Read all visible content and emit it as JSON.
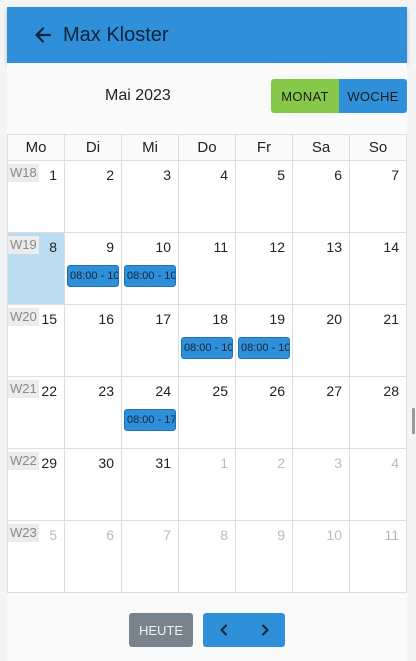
{
  "header": {
    "title": "Max Kloster",
    "back_icon": "arrow-left-icon"
  },
  "toolbar": {
    "month_label": "Mai 2023",
    "monat_label": "MONAT",
    "woche_label": "WOCHE"
  },
  "calendar": {
    "weekdays": [
      "Mo",
      "Di",
      "Mi",
      "Do",
      "Fr",
      "Sa",
      "So"
    ],
    "weeks": [
      {
        "label": "W18",
        "days": [
          "1",
          "2",
          "3",
          "4",
          "5",
          "6",
          "7"
        ]
      },
      {
        "label": "W19",
        "days": [
          "8",
          "9",
          "10",
          "11",
          "12",
          "13",
          "14"
        ]
      },
      {
        "label": "W20",
        "days": [
          "15",
          "16",
          "17",
          "18",
          "19",
          "20",
          "21"
        ]
      },
      {
        "label": "W21",
        "days": [
          "22",
          "23",
          "24",
          "25",
          "26",
          "27",
          "28"
        ]
      },
      {
        "label": "W22",
        "days": [
          "29",
          "30",
          "31",
          "1",
          "2",
          "3",
          "4"
        ]
      },
      {
        "label": "W23",
        "days": [
          "5",
          "6",
          "7",
          "8",
          "9",
          "10",
          "11"
        ]
      }
    ],
    "events": {
      "w1d1": "08:00 - 10",
      "w1d2": "08:00 - 10",
      "w2d3": "08:00 - 10",
      "w2d4": "08:00 - 10",
      "w3d2": "08:00 - 17"
    }
  },
  "footer": {
    "heute_label": "HEUTE",
    "prev_icon": "chevron-left-icon",
    "next_icon": "chevron-right-icon"
  },
  "colors": {
    "primary": "#2f8fd8",
    "accent_green": "#86c94a",
    "today_bg": "#bcdcf1",
    "button_gray": "#77838d"
  }
}
